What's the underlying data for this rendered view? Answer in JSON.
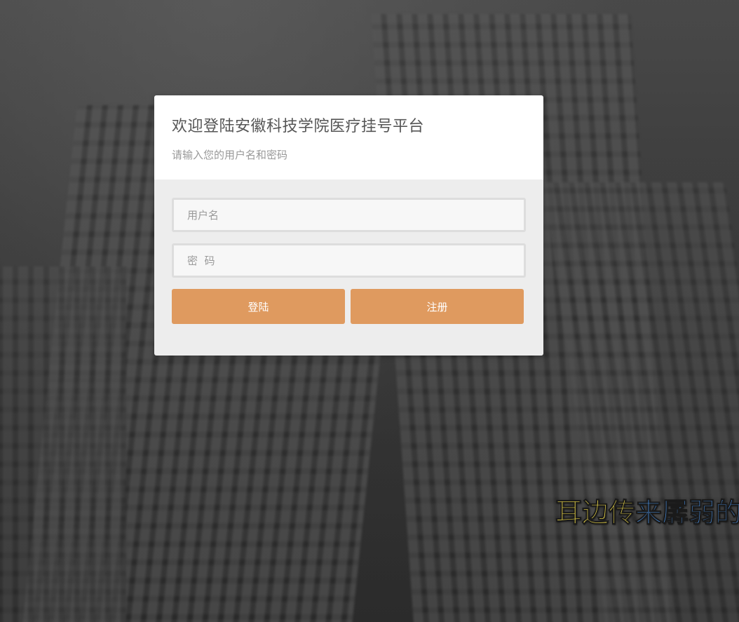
{
  "login": {
    "title": "欢迎登陆安徽科技学院医疗挂号平台",
    "subtitle": "请输入您的用户名和密码",
    "username_placeholder": "用户名",
    "password_placeholder": "密  码",
    "login_label": "登陆",
    "register_label": "注册"
  },
  "lyric": {
    "sung": "耳边传",
    "unsung": "来孱弱的叫"
  },
  "colors": {
    "button": "#df9a5f",
    "card_header": "#ffffff",
    "card_body": "#ededed",
    "lyric_sung": "#f5e04a",
    "lyric_unsung": "#4a90e2"
  }
}
